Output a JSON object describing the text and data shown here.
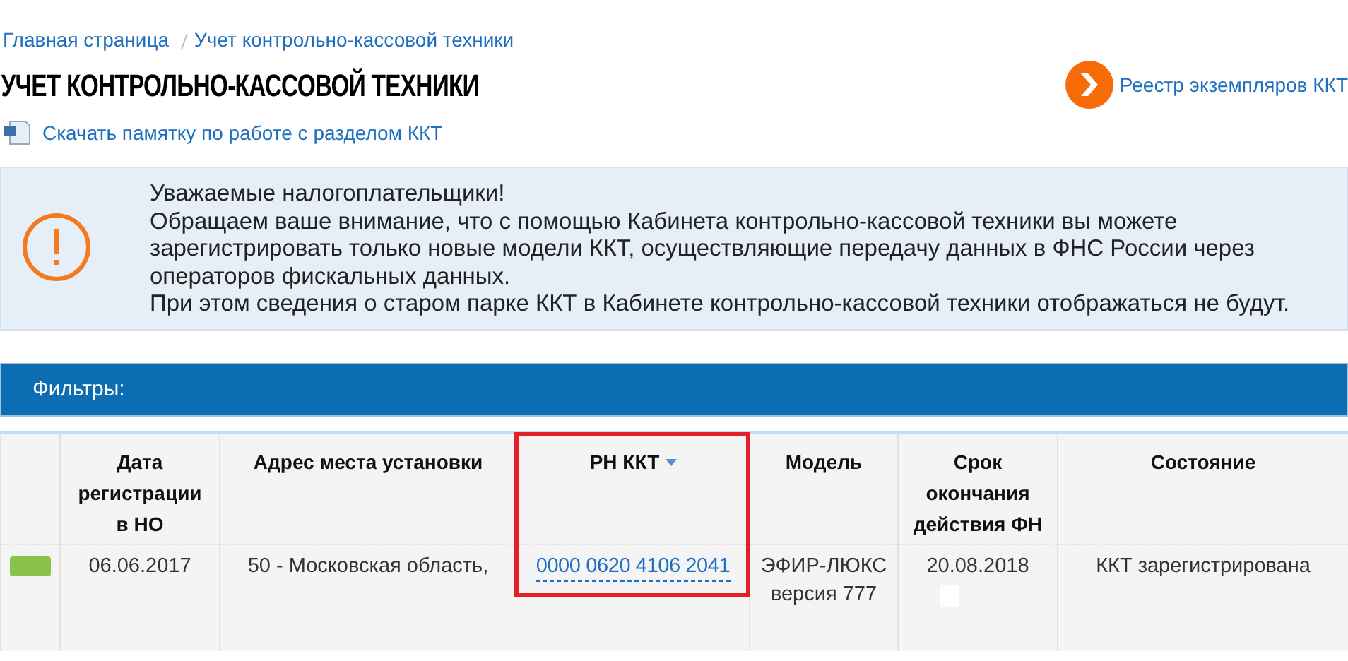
{
  "breadcrumbs": [
    {
      "label": "Главная страница"
    },
    {
      "label": "Учет контрольно-кассовой техники"
    }
  ],
  "page_title": "УЧЕТ КОНТРОЛЬНО-КАССОВОЙ ТЕХНИКИ",
  "registry_link": "Реестр экземпляров ККТ",
  "download_link": "Скачать памятку по работе с разделом ККТ",
  "notice": {
    "lines": [
      "Уважаемые налогоплательщики!",
      "Обращаем ваше внимание, что с помощью Кабинета контрольно-кассовой техники вы можете зарегистрировать только новые модели ККТ, осуществляющие передачу данных в ФНС России через операторов фискальных данных.",
      "При этом сведения о старом парке ККТ в Кабинете контрольно-кассовой техники отображаться не будут."
    ]
  },
  "filters": {
    "title": "Фильтры:"
  },
  "table": {
    "columns": [
      {
        "kind": "status",
        "highlighted": false
      },
      {
        "kind": "text",
        "label": "Дата регистрации в НО",
        "sorted": false,
        "highlighted": false
      },
      {
        "kind": "text",
        "label": "Адрес места установки",
        "sorted": false,
        "highlighted": false
      },
      {
        "kind": "link",
        "label": "РН ККТ",
        "sorted": true,
        "highlighted": true
      },
      {
        "kind": "text",
        "label": "Модель",
        "sorted": false,
        "highlighted": false
      },
      {
        "kind": "date",
        "label": "Срок окончания действия ФН",
        "sorted": false,
        "highlighted": false
      },
      {
        "kind": "text",
        "label": "Состояние",
        "sorted": false,
        "highlighted": false
      }
    ],
    "rows": [
      {
        "color": "#8bc34a",
        "cells": [
          "",
          "06.06.2017",
          "50 - Московская область,",
          "0000 0620 4106 2041",
          "ЭФИР-ЛЮКС версия 777",
          "20.08.2018",
          "ККТ зарегистрирована"
        ]
      }
    ]
  }
}
